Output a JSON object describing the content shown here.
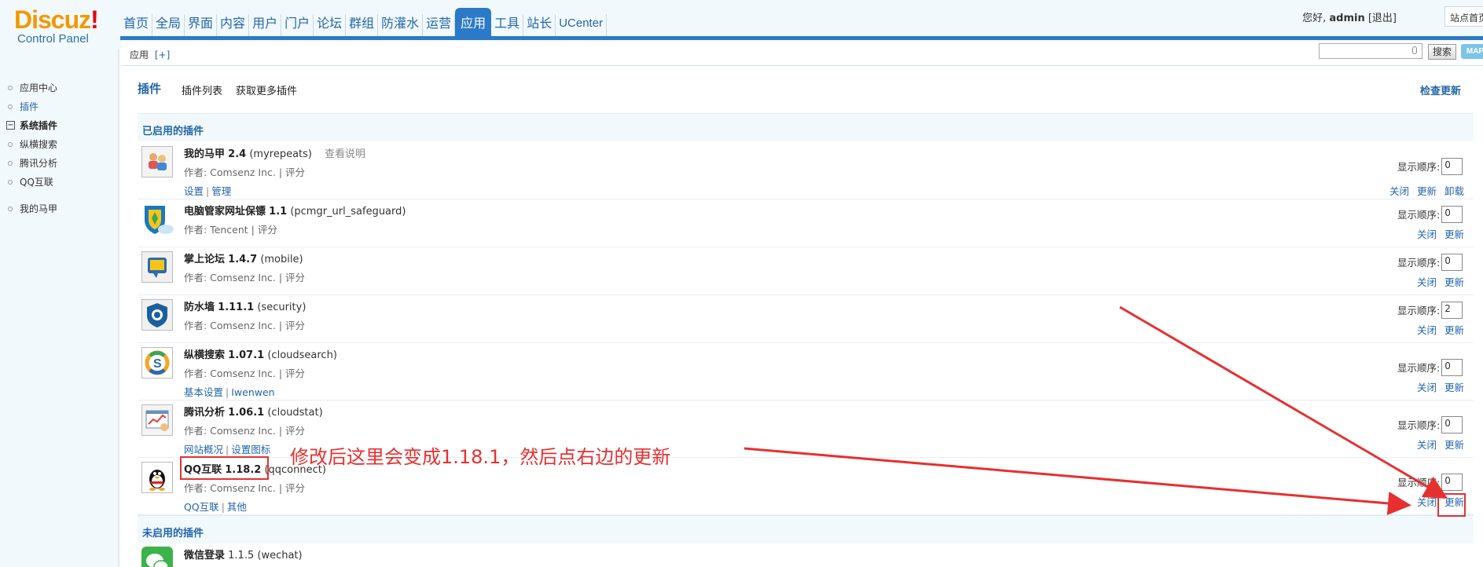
{
  "header": {
    "logo_brand": "Discuz",
    "logo_bang": "!",
    "logo_sub": "Control Panel",
    "nav": [
      "首页",
      "全局",
      "界面",
      "内容",
      "用户",
      "门户",
      "论坛",
      "群组",
      "防灌水",
      "运营",
      "应用",
      "工具",
      "站长",
      "UCenter"
    ],
    "active_nav": "应用",
    "greeting": "您好,",
    "username": "admin",
    "logout": "[退出]",
    "site_home": "站点首页"
  },
  "sidebar": {
    "items": [
      "应用中心",
      "插件",
      "系统插件",
      "纵横搜索",
      "腾讯分析",
      "QQ互联",
      "我的马甲"
    ]
  },
  "breadcrumb": {
    "label": "应用",
    "add": "[+]"
  },
  "search": {
    "button": "搜索",
    "map": "MAP"
  },
  "tabs": {
    "title": "插件",
    "list": "插件列表",
    "more": "获取更多插件",
    "check_update": "检查更新"
  },
  "sections": {
    "enabled": "已启用的插件",
    "disabled": "未启用的插件"
  },
  "labels": {
    "order": "显示顺序:",
    "close": "关闭",
    "update": "更新",
    "uninstall": "卸载",
    "docs": "查看说明"
  },
  "plugins": [
    {
      "name": "我的马甲",
      "version": "2.4",
      "id": "(myrepeats)",
      "author": "作者: Comsenz Inc. | 评分",
      "links": [
        "设置",
        "管理"
      ],
      "order": "0"
    },
    {
      "name": "电脑管家网址保镖",
      "version": "1.1",
      "id": "(pcmgr_url_safeguard)",
      "author": "作者: Tencent | 评分",
      "links": [],
      "order": "0"
    },
    {
      "name": "掌上论坛",
      "version": "1.4.7",
      "id": "(mobile)",
      "author": "作者: Comsenz Inc. | 评分",
      "links": [],
      "order": "0"
    },
    {
      "name": "防水墙",
      "version": "1.11.1",
      "id": "(security)",
      "author": "作者: Comsenz Inc. | 评分",
      "links": [],
      "order": "2"
    },
    {
      "name": "纵横搜索",
      "version": "1.07.1",
      "id": "(cloudsearch)",
      "author": "作者: Comsenz Inc. | 评分",
      "links": [
        "基本设置",
        "Iwenwen"
      ],
      "order": "0"
    },
    {
      "name": "腾讯分析",
      "version": "1.06.1",
      "id": "(cloudstat)",
      "author": "作者: Comsenz Inc. | 评分",
      "links": [
        "网站概况",
        "设置图标"
      ],
      "order": "0"
    },
    {
      "name": "QQ互联",
      "version": "1.18.2",
      "id": "(qqconnect)",
      "author": "作者: Comsenz Inc. | 评分",
      "links": [
        "QQ互联",
        "其他"
      ],
      "order": "0"
    }
  ],
  "disabled_plugins": [
    {
      "name": "微信登录",
      "version": "1.1.5",
      "id": "(wechat)"
    }
  ],
  "annotation": "修改后这里会变成1.18.1，然后点右边的更新",
  "colors": {
    "accent": "#2b7ac8",
    "link": "#2366a8",
    "highlight": "#e63030",
    "panel_bg": "#f2f9fd"
  }
}
